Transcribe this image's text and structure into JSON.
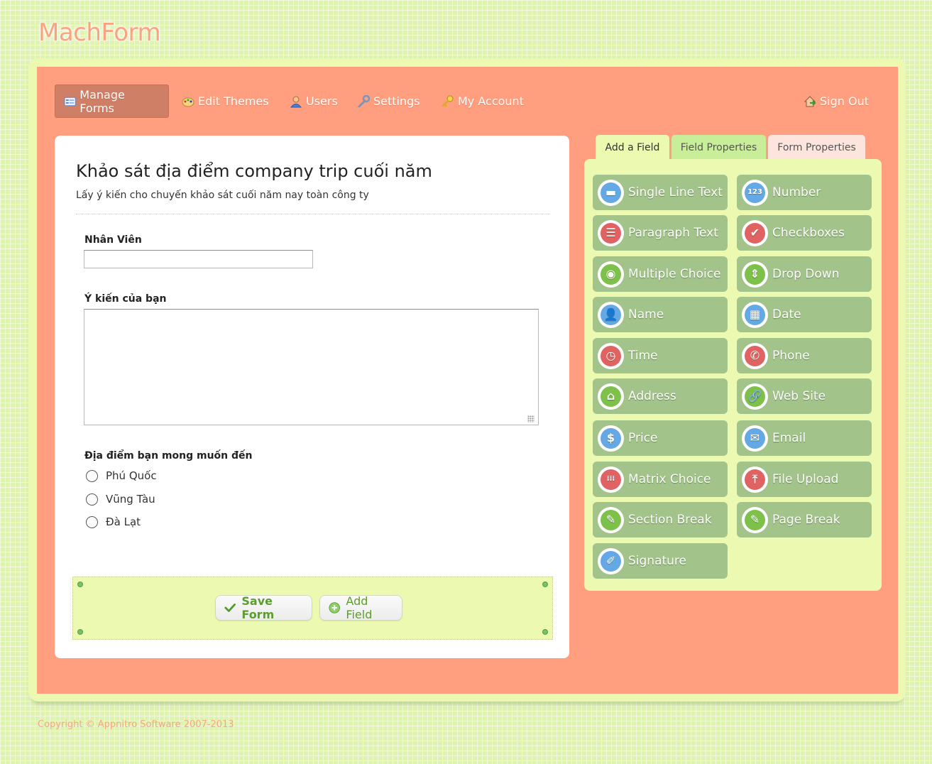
{
  "app": {
    "logo": "MachForm"
  },
  "nav": {
    "items": [
      {
        "label": "Manage Forms",
        "icon": "form-icon"
      },
      {
        "label": "Edit Themes",
        "icon": "palette-icon"
      },
      {
        "label": "Users",
        "icon": "user-icon"
      },
      {
        "label": "Settings",
        "icon": "wrench-icon"
      },
      {
        "label": "My Account",
        "icon": "key-icon"
      }
    ],
    "sign_out": "Sign Out"
  },
  "form": {
    "title": "Khảo sát địa điểm company trip cuối năm",
    "description": "Lấy ý kiến cho chuyến khảo sát cuối năm nay toàn công ty",
    "fields": {
      "employee_label": "Nhân Viên",
      "employee_value": "",
      "opinion_label": "Ý kiến của bạn",
      "opinion_value": "",
      "destination_label": "Địa điểm bạn mong muốn đến",
      "options": [
        "Phú Quốc",
        "Vũng Tàu",
        "Đà Lạt"
      ]
    },
    "buttons": {
      "save": "Save Form",
      "add": "Add Field"
    }
  },
  "tabs": [
    "Add a Field",
    "Field Properties",
    "Form Properties"
  ],
  "field_types": [
    {
      "label": "Single Line Text",
      "icon": "single-line-text-icon",
      "color": "#64a8e6",
      "glyph": "▬"
    },
    {
      "label": "Number",
      "icon": "number-icon",
      "color": "#64a8e6",
      "glyph": "123"
    },
    {
      "label": "Paragraph Text",
      "icon": "paragraph-text-icon",
      "color": "#e06262",
      "glyph": "☰"
    },
    {
      "label": "Checkboxes",
      "icon": "checkboxes-icon",
      "color": "#e06262",
      "glyph": "✔"
    },
    {
      "label": "Multiple Choice",
      "icon": "multiple-choice-icon",
      "color": "#7dc04a",
      "glyph": "◉"
    },
    {
      "label": "Drop Down",
      "icon": "drop-down-icon",
      "color": "#7dc04a",
      "glyph": "⇕"
    },
    {
      "label": "Name",
      "icon": "name-icon",
      "color": "#64a8e6",
      "glyph": "👤"
    },
    {
      "label": "Date",
      "icon": "date-icon",
      "color": "#64a8e6",
      "glyph": "▦"
    },
    {
      "label": "Time",
      "icon": "time-icon",
      "color": "#e06262",
      "glyph": "◷"
    },
    {
      "label": "Phone",
      "icon": "phone-icon",
      "color": "#e06262",
      "glyph": "✆"
    },
    {
      "label": "Address",
      "icon": "address-icon",
      "color": "#7dc04a",
      "glyph": "⌂"
    },
    {
      "label": "Web Site",
      "icon": "web-site-icon",
      "color": "#7dc04a",
      "glyph": "🔗"
    },
    {
      "label": "Price",
      "icon": "price-icon",
      "color": "#64a8e6",
      "glyph": "$"
    },
    {
      "label": "Email",
      "icon": "email-icon",
      "color": "#64a8e6",
      "glyph": "✉"
    },
    {
      "label": "Matrix Choice",
      "icon": "matrix-choice-icon",
      "color": "#e06262",
      "glyph": "⁞⁞⁞"
    },
    {
      "label": "File Upload",
      "icon": "file-upload-icon",
      "color": "#e06262",
      "glyph": "⤒"
    },
    {
      "label": "Section Break",
      "icon": "section-break-icon",
      "color": "#7dc04a",
      "glyph": "✎"
    },
    {
      "label": "Page Break",
      "icon": "page-break-icon",
      "color": "#7dc04a",
      "glyph": "✎"
    },
    {
      "label": "Signature",
      "icon": "signature-icon",
      "color": "#64a8e6",
      "glyph": "✐"
    }
  ],
  "footer": "Copyright © Appnitro Software 2007-2013",
  "colors": {
    "background": "#dff3b0",
    "panel": "#ff9f80",
    "field_button": "#a2c38a",
    "accent_green": "#5d9d2c"
  }
}
